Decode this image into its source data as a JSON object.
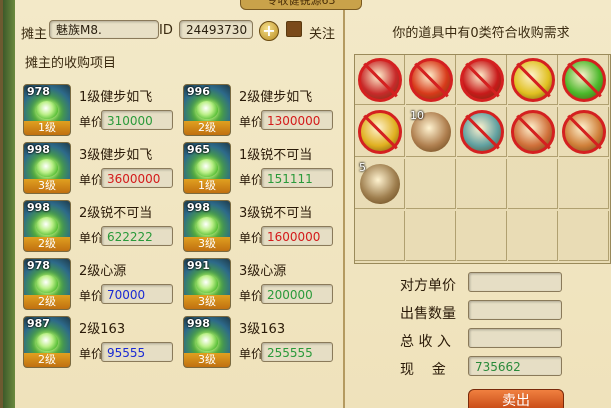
{
  "window": {
    "title": "专收健锐源63"
  },
  "topbar": {
    "owner_label": "摊主",
    "owner_name": "魅族M8.",
    "id_label": "ID",
    "id_value": "24493730",
    "add_icon": "plus-icon",
    "follow_label": "关注"
  },
  "left": {
    "section_title": "摊主的收购项目",
    "price_label": "单价",
    "entries": [
      {
        "qty": "978",
        "level": "1级",
        "name": "1级健步如飞",
        "price": "310000",
        "price_color": "#2a9a3a"
      },
      {
        "qty": "996",
        "level": "2级",
        "name": "2级健步如飞",
        "price": "1300000",
        "price_color": "#d41a1a"
      },
      {
        "qty": "998",
        "level": "3级",
        "name": "3级健步如飞",
        "price": "3600000",
        "price_color": "#d41a1a"
      },
      {
        "qty": "965",
        "level": "1级",
        "name": "1级锐不可当",
        "price": "151111",
        "price_color": "#2a9a3a"
      },
      {
        "qty": "998",
        "level": "2级",
        "name": "2级锐不可当",
        "price": "622222",
        "price_color": "#2a9a3a"
      },
      {
        "qty": "998",
        "level": "3级",
        "name": "3级锐不可当",
        "price": "1600000",
        "price_color": "#d41a1a"
      },
      {
        "qty": "978",
        "level": "2级",
        "name": "2级心源",
        "price": "70000",
        "price_color": "#1a2ad4"
      },
      {
        "qty": "991",
        "level": "3级",
        "name": "3级心源",
        "price": "200000",
        "price_color": "#2a9a3a"
      },
      {
        "qty": "987",
        "level": "2级",
        "name": "2级163",
        "price": "95555",
        "price_color": "#1a2ad4"
      },
      {
        "qty": "998",
        "level": "3级",
        "name": "3级163",
        "price": "255555",
        "price_color": "#2a9a3a"
      }
    ]
  },
  "right": {
    "header": "你的道具中有0类符合收购需求",
    "inventory": [
      {
        "icon": "red-flag-icon",
        "count": "",
        "banned": true,
        "color": "#c82a2a"
      },
      {
        "icon": "red-flag-icon",
        "count": "",
        "banned": true,
        "color": "#d83a1a"
      },
      {
        "icon": "red-flag-icon",
        "count": "",
        "banned": true,
        "color": "#c81a1a"
      },
      {
        "icon": "yellow-flag-icon",
        "count": "",
        "banned": true,
        "color": "#e0c020"
      },
      {
        "icon": "green-flag-icon",
        "count": "",
        "banned": true,
        "color": "#4ab82a"
      },
      {
        "icon": "yellow-flag-icon",
        "count": "",
        "banned": true,
        "color": "#e0b020"
      },
      {
        "icon": "scroll-icon",
        "count": "10",
        "banned": false,
        "color": "#b08050"
      },
      {
        "icon": "bowl-icon",
        "count": "",
        "banned": true,
        "color": "#60a0a0"
      },
      {
        "icon": "bun-icon",
        "count": "",
        "banned": true,
        "color": "#d0703a"
      },
      {
        "icon": "bun-icon",
        "count": "",
        "banned": true,
        "color": "#d0803a"
      },
      {
        "icon": "conch-shell-icon",
        "count": "5",
        "banned": false,
        "color": "#a08050"
      }
    ],
    "form": {
      "counter_price_label": "对方单价",
      "sell_qty_label": "出售数量",
      "total_label": "总 收 入",
      "cash_label": "现    金",
      "cash_value": "735662",
      "sell_button": "卖出"
    }
  }
}
